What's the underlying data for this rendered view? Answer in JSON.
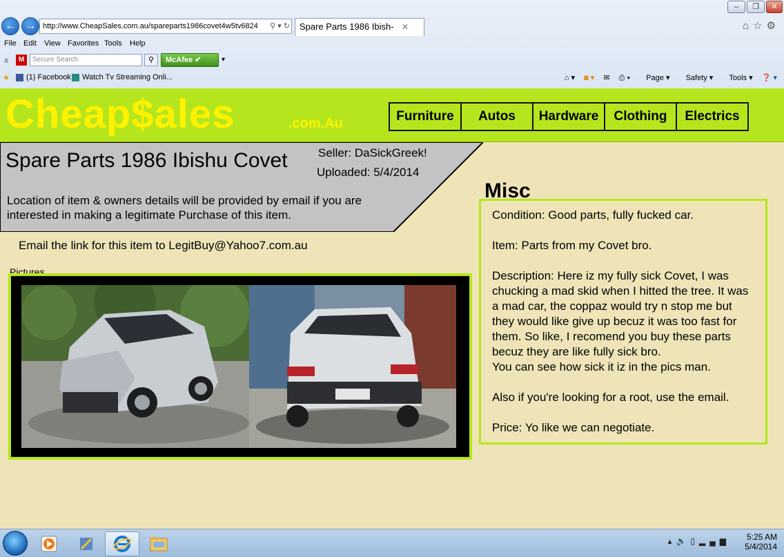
{
  "browser": {
    "url": "http://www.CheapSales.com.au/spareparts1986covet4w5tv6824",
    "tab_title": "Spare Parts 1986 Ibish-",
    "menu": [
      "File",
      "Edit",
      "View",
      "Favorites",
      "Tools",
      "Help"
    ],
    "search_placeholder": "Secure Search",
    "mcafee_label": "McAfee",
    "favorites": [
      "(1) Facebook",
      "Watch Tv Streaming Onli..."
    ],
    "command_bar": [
      "Page",
      "Safety",
      "Tools"
    ]
  },
  "site": {
    "logo_main": "Cheap$ales",
    "logo_sub": ".com.Au",
    "nav": [
      "Furniture",
      "Autos",
      "Hardware",
      "Clothing",
      "Electrics"
    ]
  },
  "listing": {
    "title": "Spare Parts 1986 Ibishu Covet",
    "seller": "Seller: DaSickGreek!",
    "uploaded": "Uploaded: 5/4/2014",
    "location_note": "Location of item & owners details will be provided by email if you are interested in making a legitimate Purchase of this item.",
    "email_line": "Email the link for this item to LegitBuy@Yahoo7.com.au",
    "pictures_label": "Pictures"
  },
  "misc": {
    "heading": "Misc",
    "condition": "Condition: Good parts, fully fucked car.",
    "item": "Item: Parts from my Covet bro.",
    "description": "Description: Here iz my fully sick Covet, I was chucking a mad skid when I hitted the tree. It was a mad car, the coppaz would try n stop me but they would like give up becuz it was too fast for them. So like, I recomend you buy these parts becuz they are like fully sick bro.",
    "description2": "You can see how sick it iz in the pics man.",
    "root_note": "Also if you're looking for a root, use the email.",
    "price": "Price: Yo like we can negotiate."
  },
  "taskbar": {
    "time": "5:25 AM",
    "date": "5/4/2014"
  },
  "colors": {
    "accent": "#b5e61d",
    "logo": "#fff200",
    "page_bg": "#eee4b8",
    "gray_panel": "#c3c3c3"
  }
}
